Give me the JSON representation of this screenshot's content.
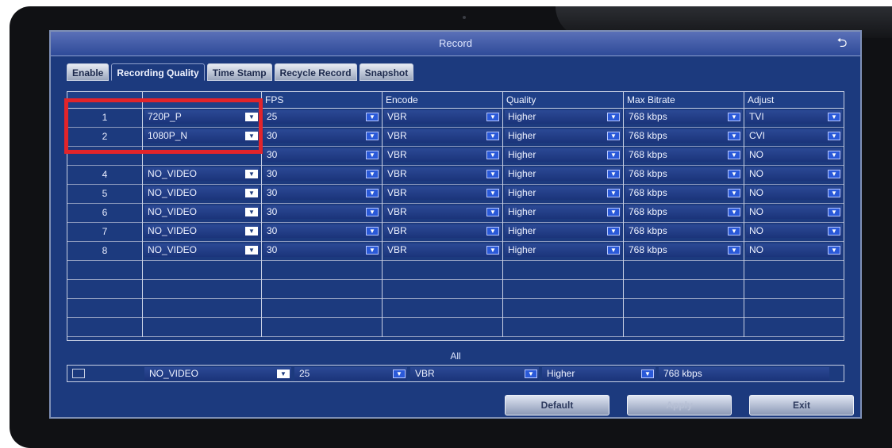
{
  "window": {
    "title": "Record"
  },
  "tabs": [
    {
      "label": "Enable"
    },
    {
      "label": "Recording Quality"
    },
    {
      "label": "Time Stamp"
    },
    {
      "label": "Recycle Record"
    },
    {
      "label": "Snapshot"
    }
  ],
  "columns": [
    "",
    "",
    "FPS",
    "Encode",
    "Quality",
    "Max Bitrate",
    "Adjust"
  ],
  "rows": [
    {
      "ch": "1",
      "res": "720P_P",
      "fps": "25",
      "enc": "VBR",
      "q": "Higher",
      "br": "768 kbps",
      "adj": "TVI"
    },
    {
      "ch": "2",
      "res": "1080P_N",
      "fps": "30",
      "enc": "VBR",
      "q": "Higher",
      "br": "768 kbps",
      "adj": "CVI"
    },
    {
      "ch": "",
      "res": "",
      "fps": "30",
      "enc": "VBR",
      "q": "Higher",
      "br": "768 kbps",
      "adj": "NO"
    },
    {
      "ch": "4",
      "res": "NO_VIDEO",
      "fps": "30",
      "enc": "VBR",
      "q": "Higher",
      "br": "768 kbps",
      "adj": "NO"
    },
    {
      "ch": "5",
      "res": "NO_VIDEO",
      "fps": "30",
      "enc": "VBR",
      "q": "Higher",
      "br": "768 kbps",
      "adj": "NO"
    },
    {
      "ch": "6",
      "res": "NO_VIDEO",
      "fps": "30",
      "enc": "VBR",
      "q": "Higher",
      "br": "768 kbps",
      "adj": "NO"
    },
    {
      "ch": "7",
      "res": "NO_VIDEO",
      "fps": "30",
      "enc": "VBR",
      "q": "Higher",
      "br": "768 kbps",
      "adj": "NO"
    },
    {
      "ch": "8",
      "res": "NO_VIDEO",
      "fps": "30",
      "enc": "VBR",
      "q": "Higher",
      "br": "768 kbps",
      "adj": "NO"
    }
  ],
  "empty_rows": 4,
  "all": {
    "label": "All",
    "res": "NO_VIDEO",
    "fps": "25",
    "enc": "VBR",
    "q": "Higher",
    "br": "768 kbps"
  },
  "buttons": {
    "default": "Default",
    "apply": "Apply",
    "exit": "Exit"
  },
  "colors": {
    "window_bg": "#1c3a7e",
    "highlight": "#e2242a",
    "caret": "#2a59d8"
  }
}
